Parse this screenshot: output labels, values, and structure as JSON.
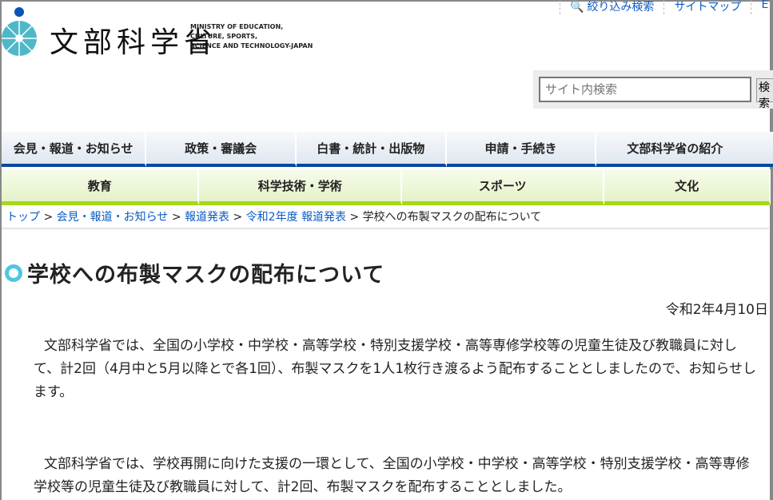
{
  "header": {
    "logo_jp": "文部科学省",
    "logo_en": [
      "MINISTRY OF EDUCATION,",
      "CULTURE, SPORTS,",
      "SCIENCE AND TECHNOLOGY-JAPAN"
    ],
    "links": [
      "絞り込み検索",
      "サイトマップ",
      "E"
    ],
    "search": {
      "placeholder": "サイト内検索",
      "button": "検索"
    }
  },
  "nav_primary": [
    "会見・報道・お知らせ",
    "政策・審議会",
    "白書・統計・出版物",
    "申請・手続き",
    "文部科学省の紹介"
  ],
  "nav_secondary": [
    "教育",
    "科学技術・学術",
    "スポーツ",
    "文化"
  ],
  "breadcrumb": [
    "トップ",
    "会見・報道・お知らせ",
    "報道発表",
    "令和2年度 報道発表",
    "学校への布製マスクの配布について"
  ],
  "article": {
    "title": "学校への布製マスクの配布について",
    "date": "令和2年4月10日",
    "paragraphs": [
      "文部科学省では、全国の小学校・中学校・高等学校・特別支援学校・高等専修学校等の児童生徒及び教職員に対して、計2回（4月中と5月以降とで各1回）、布製マスクを1人1枚行き渡るよう配布することとしましたので、お知らせします。",
      "文部科学省では、学校再開に向けた支援の一環として、全国の小学校・中学校・高等学校・特別支援学校・高等専修学校等の児童生徒及び教職員に対して、計2回、布製マスクを配布することとしました。"
    ]
  }
}
